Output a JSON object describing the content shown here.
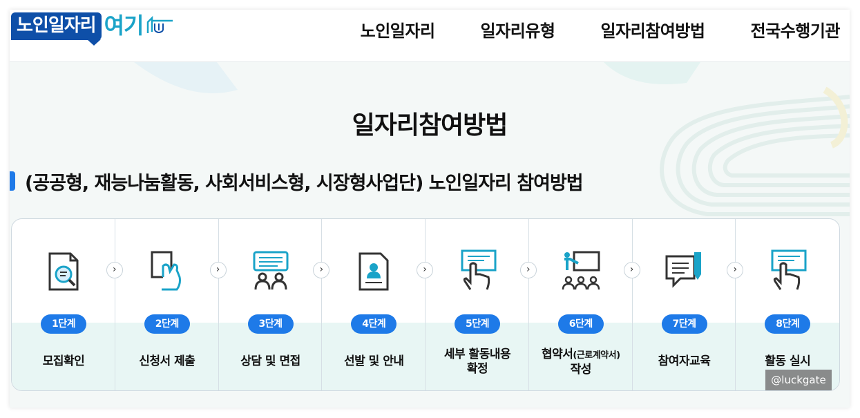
{
  "logo": {
    "main": "노인일자리",
    "sub": "여기"
  },
  "nav": {
    "items": [
      "노인일자리",
      "일자리유형",
      "일자리참여방법",
      "전국수행기관"
    ]
  },
  "page_title": "일자리참여방법",
  "section_title": "(공공형, 재능나눔활동, 사회서비스형, 시장형사업단) 노인일자리 참여방법",
  "steps": [
    {
      "badge": "1단계",
      "label": "모집확인",
      "icon": "document-search-icon"
    },
    {
      "badge": "2단계",
      "label": "신청서 제출",
      "icon": "hand-submit-icon"
    },
    {
      "badge": "3단계",
      "label": "상담 및 면접",
      "icon": "interview-icon"
    },
    {
      "badge": "4단계",
      "label": "선발 및 안내",
      "icon": "profile-document-icon"
    },
    {
      "badge": "5단계",
      "label_line1": "세부 활동내용",
      "label_line2": "확정",
      "icon": "touch-screen-icon"
    },
    {
      "badge": "6단계",
      "label_line1": "협약서",
      "label_small": "(근로계약서)",
      "label_line2": "작성",
      "icon": "presentation-icon"
    },
    {
      "badge": "7단계",
      "label": "참여자교육",
      "icon": "chat-pen-icon"
    },
    {
      "badge": "8단계",
      "label": "활동 실시",
      "icon": "touch-screen-icon"
    }
  ],
  "watermark": "@luckgate",
  "colors": {
    "brand": "#0e4fa8",
    "accent": "#1e7ae8",
    "logo_sub": "#1aa3c8",
    "step_bg": "#e8f6f4"
  }
}
